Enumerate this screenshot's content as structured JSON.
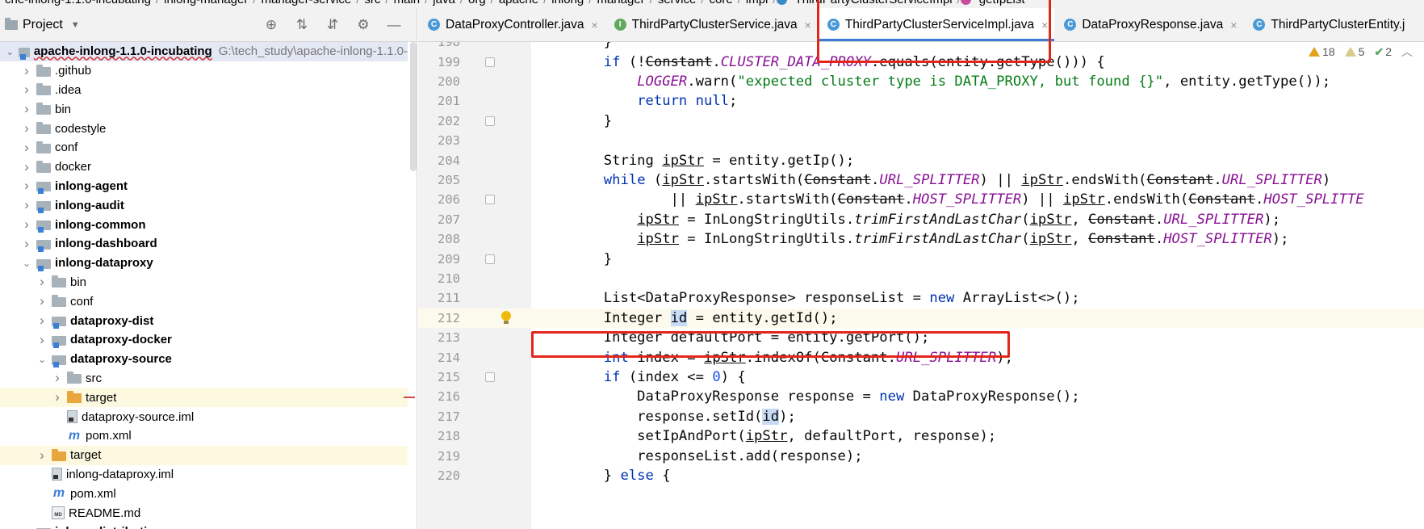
{
  "breadcrumb": [
    "che-inlong-1.1.0-incubating",
    "inlong-manager",
    "manager-service",
    "src",
    "main",
    "java",
    "org",
    "apache",
    "inlong",
    "manager",
    "service",
    "core",
    "impl",
    "ThirdPartyClusterServiceImpl",
    "getIpList"
  ],
  "project_panel": {
    "title": "Project",
    "tree": [
      {
        "label": "apache-inlong-1.1.0-incubating",
        "hint": "G:\\tech_study\\apache-inlong-1.1.0-",
        "depth": 0,
        "arrow": "open",
        "icon": "module",
        "bold": true
      },
      {
        "label": ".github",
        "depth": 1,
        "arrow": "closed",
        "icon": "folder"
      },
      {
        "label": ".idea",
        "depth": 1,
        "arrow": "closed",
        "icon": "folder"
      },
      {
        "label": "bin",
        "depth": 1,
        "arrow": "closed",
        "icon": "folder"
      },
      {
        "label": "codestyle",
        "depth": 1,
        "arrow": "closed",
        "icon": "folder"
      },
      {
        "label": "conf",
        "depth": 1,
        "arrow": "closed",
        "icon": "folder"
      },
      {
        "label": "docker",
        "depth": 1,
        "arrow": "closed",
        "icon": "folder"
      },
      {
        "label": "inlong-agent",
        "depth": 1,
        "arrow": "closed",
        "icon": "module",
        "bold": true
      },
      {
        "label": "inlong-audit",
        "depth": 1,
        "arrow": "closed",
        "icon": "module",
        "bold": true
      },
      {
        "label": "inlong-common",
        "depth": 1,
        "arrow": "closed",
        "icon": "module",
        "bold": true
      },
      {
        "label": "inlong-dashboard",
        "depth": 1,
        "arrow": "closed",
        "icon": "module",
        "bold": true
      },
      {
        "label": "inlong-dataproxy",
        "depth": 1,
        "arrow": "open",
        "icon": "module",
        "bold": true
      },
      {
        "label": "bin",
        "depth": 2,
        "arrow": "closed",
        "icon": "folder"
      },
      {
        "label": "conf",
        "depth": 2,
        "arrow": "closed",
        "icon": "folder"
      },
      {
        "label": "dataproxy-dist",
        "depth": 2,
        "arrow": "closed",
        "icon": "module",
        "bold": true
      },
      {
        "label": "dataproxy-docker",
        "depth": 2,
        "arrow": "closed",
        "icon": "module",
        "bold": true
      },
      {
        "label": "dataproxy-source",
        "depth": 2,
        "arrow": "open",
        "icon": "module",
        "bold": true
      },
      {
        "label": "src",
        "depth": 3,
        "arrow": "closed",
        "icon": "folder"
      },
      {
        "label": "target",
        "depth": 3,
        "arrow": "closed",
        "icon": "excluded",
        "highlight": true
      },
      {
        "label": "dataproxy-source.iml",
        "depth": 3,
        "arrow": "none",
        "icon": "iml"
      },
      {
        "label": "pom.xml",
        "depth": 3,
        "arrow": "none",
        "icon": "maven"
      },
      {
        "label": "target",
        "depth": 2,
        "arrow": "closed",
        "icon": "excluded",
        "highlight": true
      },
      {
        "label": "inlong-dataproxy.iml",
        "depth": 2,
        "arrow": "none",
        "icon": "iml"
      },
      {
        "label": "pom.xml",
        "depth": 2,
        "arrow": "none",
        "icon": "maven"
      },
      {
        "label": "README.md",
        "depth": 2,
        "arrow": "none",
        "icon": "md"
      },
      {
        "label": "inlong-distribution",
        "depth": 1,
        "arrow": "closed",
        "icon": "module",
        "bold": true
      }
    ]
  },
  "tabs": [
    {
      "label": "DataProxyController.java",
      "kind": "class",
      "closable": true,
      "active": false
    },
    {
      "label": "ThirdPartyClusterService.java",
      "kind": "interface",
      "closable": true,
      "active": false
    },
    {
      "label": "ThirdPartyClusterServiceImpl.java",
      "kind": "class",
      "closable": true,
      "active": true
    },
    {
      "label": "DataProxyResponse.java",
      "kind": "class",
      "closable": true,
      "active": false
    },
    {
      "label": "ThirdPartyClusterEntity.j",
      "kind": "class",
      "closable": false,
      "active": false
    }
  ],
  "inspections": {
    "warnings": "18",
    "weak_warnings": "5",
    "ok": "2"
  },
  "editor": {
    "first_line": 198,
    "lines": [
      {
        "n": 198,
        "segs": [
          {
            "t": "        }",
            "c": ""
          }
        ]
      },
      {
        "n": 199,
        "segs": [
          {
            "t": "        ",
            "c": ""
          },
          {
            "t": "if",
            "c": "kw"
          },
          {
            "t": " (!",
            "c": ""
          },
          {
            "t": "Constant",
            "c": "strike"
          },
          {
            "t": ".",
            "c": ""
          },
          {
            "t": "CLUSTER_DATA_PROXY",
            "c": "const"
          },
          {
            "t": ".equals(entity.getType())) {",
            "c": ""
          }
        ]
      },
      {
        "n": 200,
        "segs": [
          {
            "t": "            ",
            "c": ""
          },
          {
            "t": "LOGGER",
            "c": "const"
          },
          {
            "t": ".warn(",
            "c": ""
          },
          {
            "t": "\"expected cluster type is DATA_PROXY, but found {}\"",
            "c": "str"
          },
          {
            "t": ", entity.getType());",
            "c": ""
          }
        ]
      },
      {
        "n": 201,
        "segs": [
          {
            "t": "            ",
            "c": ""
          },
          {
            "t": "return null",
            "c": "kw"
          },
          {
            "t": ";",
            "c": ""
          }
        ]
      },
      {
        "n": 202,
        "segs": [
          {
            "t": "        }",
            "c": ""
          }
        ]
      },
      {
        "n": 203,
        "segs": []
      },
      {
        "n": 204,
        "segs": [
          {
            "t": "        String ",
            "c": ""
          },
          {
            "t": "ipStr",
            "c": "uline"
          },
          {
            "t": " = entity.getIp();",
            "c": ""
          }
        ]
      },
      {
        "n": 205,
        "segs": [
          {
            "t": "        ",
            "c": ""
          },
          {
            "t": "while",
            "c": "kw"
          },
          {
            "t": " (",
            "c": ""
          },
          {
            "t": "ipStr",
            "c": "uline"
          },
          {
            "t": ".startsWith(",
            "c": ""
          },
          {
            "t": "Constant",
            "c": "strike"
          },
          {
            "t": ".",
            "c": ""
          },
          {
            "t": "URL_SPLITTER",
            "c": "const"
          },
          {
            "t": ") || ",
            "c": ""
          },
          {
            "t": "ipStr",
            "c": "uline"
          },
          {
            "t": ".endsWith(",
            "c": ""
          },
          {
            "t": "Constant",
            "c": "strike"
          },
          {
            "t": ".",
            "c": ""
          },
          {
            "t": "URL_SPLITTER",
            "c": "const"
          },
          {
            "t": ")",
            "c": ""
          }
        ]
      },
      {
        "n": 206,
        "segs": [
          {
            "t": "                || ",
            "c": ""
          },
          {
            "t": "ipStr",
            "c": "uline"
          },
          {
            "t": ".startsWith(",
            "c": ""
          },
          {
            "t": "Constant",
            "c": "strike"
          },
          {
            "t": ".",
            "c": ""
          },
          {
            "t": "HOST_SPLITTER",
            "c": "const"
          },
          {
            "t": ") || ",
            "c": ""
          },
          {
            "t": "ipStr",
            "c": "uline"
          },
          {
            "t": ".endsWith(",
            "c": ""
          },
          {
            "t": "Constant",
            "c": "strike"
          },
          {
            "t": ".",
            "c": ""
          },
          {
            "t": "HOST_SPLITTE",
            "c": "const"
          }
        ]
      },
      {
        "n": 207,
        "segs": [
          {
            "t": "            ",
            "c": ""
          },
          {
            "t": "ipStr",
            "c": "uline"
          },
          {
            "t": " = InLongStringUtils.",
            "c": ""
          },
          {
            "t": "trimFirstAndLastChar",
            "c": "ital"
          },
          {
            "t": "(",
            "c": ""
          },
          {
            "t": "ipStr",
            "c": "uline"
          },
          {
            "t": ", ",
            "c": ""
          },
          {
            "t": "Constant",
            "c": "strike"
          },
          {
            "t": ".",
            "c": ""
          },
          {
            "t": "URL_SPLITTER",
            "c": "const"
          },
          {
            "t": ");",
            "c": ""
          }
        ]
      },
      {
        "n": 208,
        "segs": [
          {
            "t": "            ",
            "c": ""
          },
          {
            "t": "ipStr",
            "c": "uline"
          },
          {
            "t": " = InLongStringUtils.",
            "c": ""
          },
          {
            "t": "trimFirstAndLastChar",
            "c": "ital"
          },
          {
            "t": "(",
            "c": ""
          },
          {
            "t": "ipStr",
            "c": "uline"
          },
          {
            "t": ", ",
            "c": ""
          },
          {
            "t": "Constant",
            "c": "strike"
          },
          {
            "t": ".",
            "c": ""
          },
          {
            "t": "HOST_SPLITTER",
            "c": "const"
          },
          {
            "t": ");",
            "c": ""
          }
        ]
      },
      {
        "n": 209,
        "segs": [
          {
            "t": "        }",
            "c": ""
          }
        ]
      },
      {
        "n": 210,
        "segs": []
      },
      {
        "n": 211,
        "segs": [
          {
            "t": "        List<DataProxyResponse> responseList = ",
            "c": ""
          },
          {
            "t": "new",
            "c": "kw"
          },
          {
            "t": " ArrayList<>();",
            "c": ""
          }
        ]
      },
      {
        "n": 212,
        "segs": [
          {
            "t": "        Integer ",
            "c": ""
          },
          {
            "t": "id",
            "c": "hl"
          },
          {
            "t": " = entity.getId();",
            "c": ""
          }
        ],
        "current": true
      },
      {
        "n": 213,
        "segs": [
          {
            "t": "        Integer defaultPort = entity.getPort();",
            "c": ""
          }
        ]
      },
      {
        "n": 214,
        "segs": [
          {
            "t": "        ",
            "c": ""
          },
          {
            "t": "int",
            "c": "kw"
          },
          {
            "t": " index = ",
            "c": ""
          },
          {
            "t": "ipStr",
            "c": "uline"
          },
          {
            "t": ".indexOf(",
            "c": ""
          },
          {
            "t": "Constant",
            "c": "strike"
          },
          {
            "t": ".",
            "c": ""
          },
          {
            "t": "URL_SPLITTER",
            "c": "const"
          },
          {
            "t": ");",
            "c": ""
          }
        ]
      },
      {
        "n": 215,
        "segs": [
          {
            "t": "        ",
            "c": ""
          },
          {
            "t": "if",
            "c": "kw"
          },
          {
            "t": " (index <= ",
            "c": ""
          },
          {
            "t": "0",
            "c": "num"
          },
          {
            "t": ") {",
            "c": ""
          }
        ]
      },
      {
        "n": 216,
        "segs": [
          {
            "t": "            DataProxyResponse response = ",
            "c": ""
          },
          {
            "t": "new",
            "c": "kw"
          },
          {
            "t": " DataProxyResponse();",
            "c": ""
          }
        ]
      },
      {
        "n": 217,
        "segs": [
          {
            "t": "            response.setId(",
            "c": ""
          },
          {
            "t": "id",
            "c": "hl"
          },
          {
            "t": ");",
            "c": ""
          }
        ]
      },
      {
        "n": 218,
        "segs": [
          {
            "t": "            setIpAndPort(",
            "c": ""
          },
          {
            "t": "ipStr",
            "c": "uline"
          },
          {
            "t": ", defaultPort, response);",
            "c": ""
          }
        ]
      },
      {
        "n": 219,
        "segs": [
          {
            "t": "            responseList.add(response);",
            "c": ""
          }
        ]
      },
      {
        "n": 220,
        "segs": [
          {
            "t": "        } ",
            "c": ""
          },
          {
            "t": "else",
            "c": "kw"
          },
          {
            "t": " {",
            "c": ""
          }
        ]
      }
    ]
  }
}
